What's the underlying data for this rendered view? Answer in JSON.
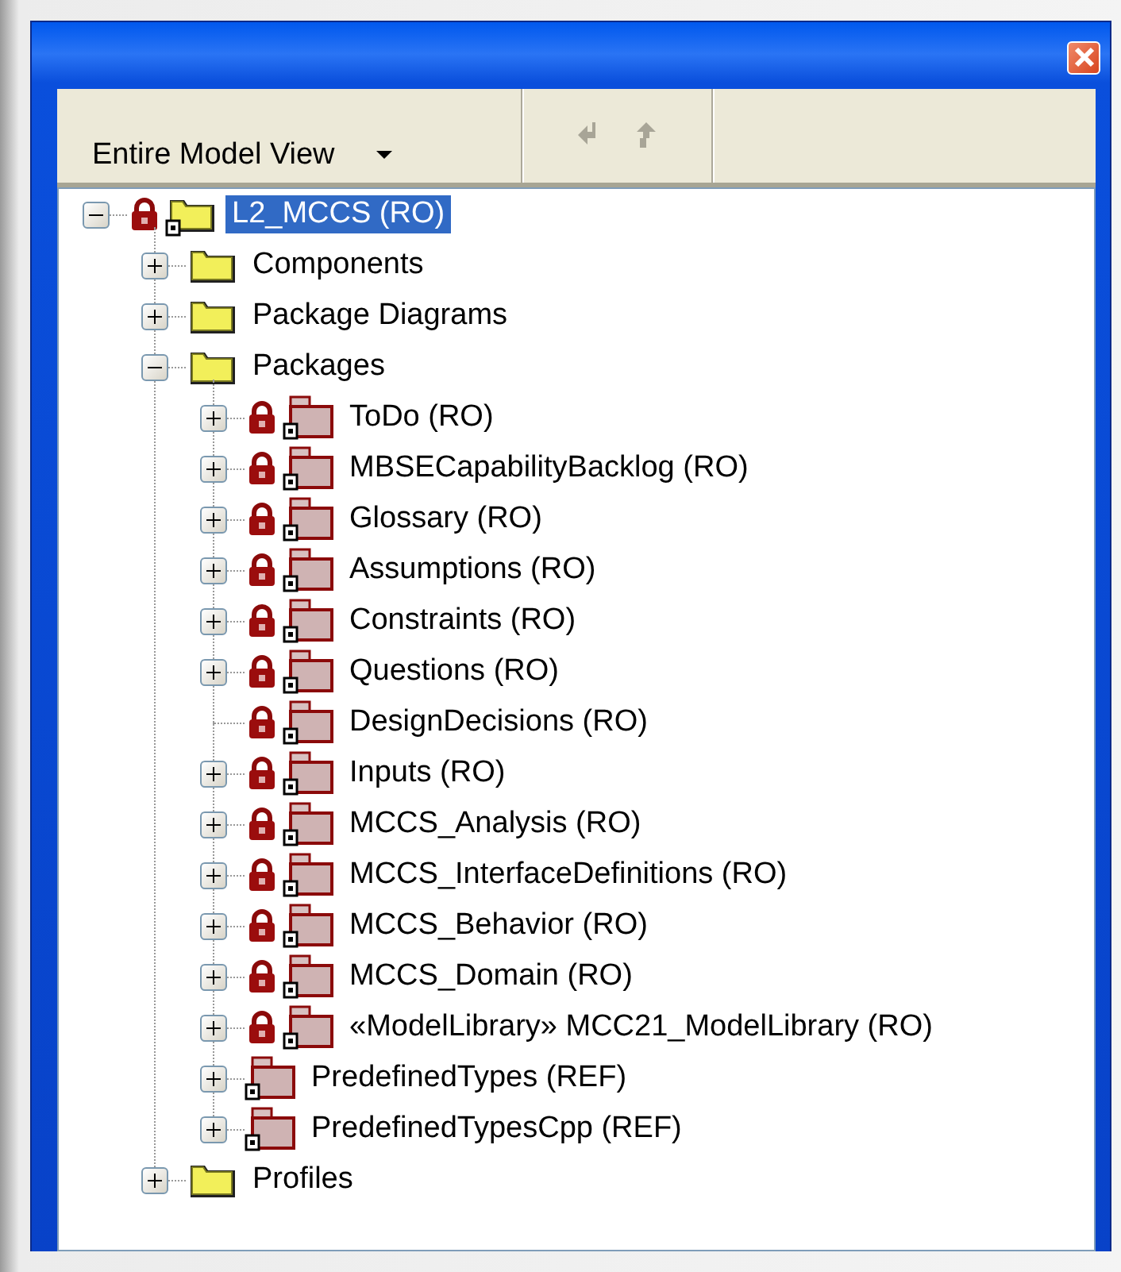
{
  "toolbar": {
    "view_dropdown": {
      "value": "Entire Model View"
    },
    "buttons": [
      {
        "kind": "back",
        "disabled": true
      },
      {
        "kind": "up",
        "disabled": true
      }
    ]
  },
  "tree": [
    {
      "label": "L2_MCCS (RO)",
      "kind": "folder",
      "locked": true,
      "referenced": true,
      "selected": true,
      "expanded": true,
      "children": [
        {
          "label": "Components",
          "kind": "folder",
          "locked": false,
          "referenced": false,
          "selected": false,
          "expanded": false
        },
        {
          "label": "Package Diagrams",
          "kind": "folder",
          "locked": false,
          "referenced": false,
          "selected": false,
          "expanded": false
        },
        {
          "label": "Packages",
          "kind": "folder",
          "locked": false,
          "referenced": false,
          "selected": false,
          "expanded": true,
          "children": [
            {
              "label": "ToDo (RO)",
              "kind": "package",
              "locked": true,
              "referenced": true,
              "selected": false,
              "expanded": false
            },
            {
              "label": "MBSECapabilityBacklog (RO)",
              "kind": "package",
              "locked": true,
              "referenced": true,
              "selected": false,
              "expanded": false
            },
            {
              "label": "Glossary (RO)",
              "kind": "package",
              "locked": true,
              "referenced": true,
              "selected": false,
              "expanded": false
            },
            {
              "label": "Assumptions (RO)",
              "kind": "package",
              "locked": true,
              "referenced": true,
              "selected": false,
              "expanded": false
            },
            {
              "label": "Constraints (RO)",
              "kind": "package",
              "locked": true,
              "referenced": true,
              "selected": false,
              "expanded": false
            },
            {
              "label": "Questions (RO)",
              "kind": "package",
              "locked": true,
              "referenced": true,
              "selected": false,
              "expanded": false
            },
            {
              "label": "DesignDecisions (RO)",
              "kind": "package",
              "locked": true,
              "referenced": true,
              "selected": false
            },
            {
              "label": "Inputs (RO)",
              "kind": "package",
              "locked": true,
              "referenced": true,
              "selected": false,
              "expanded": false
            },
            {
              "label": "MCCS_Analysis (RO)",
              "kind": "package",
              "locked": true,
              "referenced": true,
              "selected": false,
              "expanded": false
            },
            {
              "label": "MCCS_InterfaceDefinitions (RO)",
              "kind": "package",
              "locked": true,
              "referenced": true,
              "selected": false,
              "expanded": false
            },
            {
              "label": "MCCS_Behavior (RO)",
              "kind": "package",
              "locked": true,
              "referenced": true,
              "selected": false,
              "expanded": false
            },
            {
              "label": "MCCS_Domain (RO)",
              "kind": "package",
              "locked": true,
              "referenced": true,
              "selected": false,
              "expanded": false
            },
            {
              "label": "«ModelLibrary» MCC21_ModelLibrary (RO)",
              "kind": "package",
              "locked": true,
              "referenced": true,
              "selected": false,
              "expanded": false
            },
            {
              "label": "PredefinedTypes (REF)",
              "kind": "package",
              "locked": false,
              "referenced": true,
              "selected": false,
              "expanded": false
            },
            {
              "label": "PredefinedTypesCpp (REF)",
              "kind": "package",
              "locked": false,
              "referenced": true,
              "selected": false,
              "expanded": false
            }
          ]
        },
        {
          "label": "Profiles",
          "kind": "folder",
          "locked": false,
          "referenced": false,
          "selected": false,
          "expanded": false
        }
      ]
    }
  ]
}
